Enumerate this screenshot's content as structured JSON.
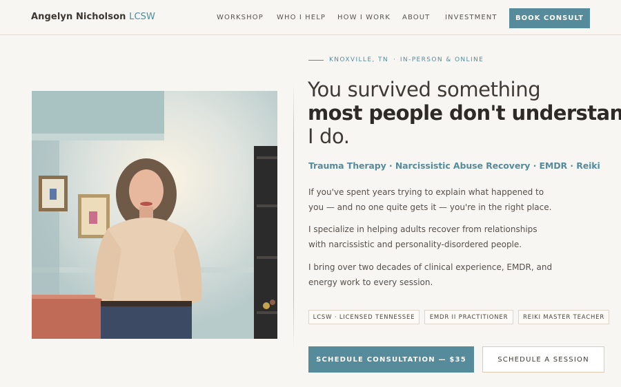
{
  "header": {
    "brand_name": "Angelyn Nicholson",
    "brand_credential": "LCSW",
    "nav": [
      "WORKSHOP",
      "WHO I HELP",
      "HOW I WORK",
      "ABOUT",
      "INVESTMENT"
    ],
    "cta": "BOOK CONSULT"
  },
  "hero": {
    "location": "KNOXVILLE, TN",
    "separator": "·",
    "mode": "IN-PERSON & ONLINE",
    "headline_1": "You survived something",
    "headline_2": "most people don't understand.",
    "headline_3": "I do.",
    "services": "Trauma Therapy · Narcissistic Abuse Recovery · EMDR · Reiki",
    "paragraphs": [
      "If you've spent years trying to explain what happened to you — and no one quite gets it — you're in the right place.",
      "I specialize in helping adults recover from relationships with narcissistic and personality-disordered people.",
      "I bring over two decades of clinical experience, EMDR, and energy work to every session."
    ],
    "badges": [
      "LCSW · LICENSED TENNESSEE",
      "EMDR II PRACTITIONER",
      "REIKI MASTER TEACHER"
    ],
    "primary_button": "SCHEDULE CONSULTATION — $35",
    "secondary_button": "SCHEDULE A SESSION"
  },
  "colors": {
    "accent": "#568b9b",
    "background": "#f8f6f2",
    "text": "#3f3a35"
  }
}
